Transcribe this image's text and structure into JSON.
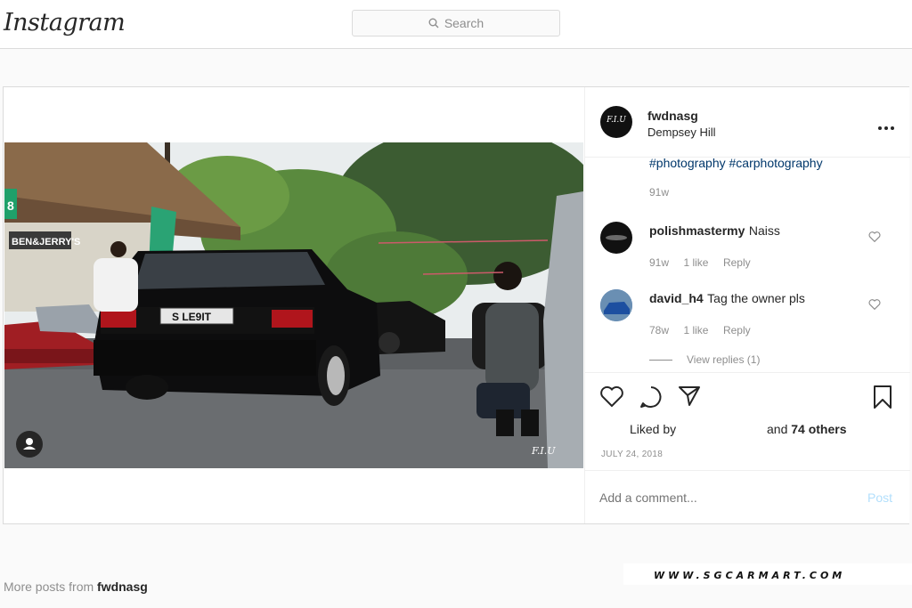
{
  "app": {
    "logo": "Instagram"
  },
  "search": {
    "placeholder": "Search",
    "icon": "search-icon"
  },
  "post": {
    "username": "fwdnasg",
    "location": "Dempsey Hill",
    "avatar_text": "F.I.U",
    "caption_tags": "#photography #carphotography",
    "caption_time": "91w",
    "photo": {
      "plate": "S LE9IT",
      "shop_sign": "BEN&JERRY'S",
      "photo_watermark": "F.I.U",
      "number_sign": "8"
    },
    "comments": [
      {
        "user": "polishmastermy",
        "text": "Naiss",
        "time": "91w",
        "likes": "1 like",
        "reply": "Reply"
      },
      {
        "user": "david_h4",
        "text": "Tag the owner pls",
        "time": "78w",
        "likes": "1 like",
        "reply": "Reply"
      }
    ],
    "view_replies": "View replies (1)",
    "liked_by": "Liked by",
    "others_prefix": "and",
    "others_count": "74 others",
    "date": "JULY 24, 2018",
    "add_comment_placeholder": "Add a comment...",
    "post_button": "Post"
  },
  "more_posts": {
    "prefix": "More posts from",
    "user": "fwdnasg"
  },
  "site_watermark": "WWW.SGCARMART.COM"
}
